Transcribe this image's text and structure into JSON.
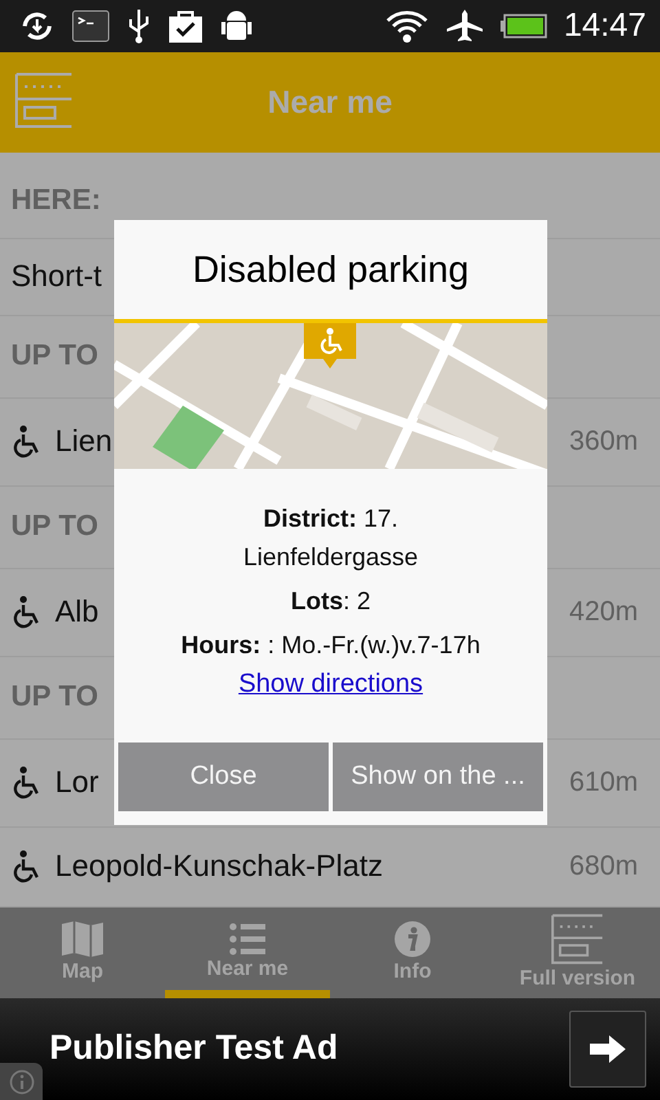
{
  "status_bar": {
    "time": "14:47"
  },
  "header": {
    "title": "Near me"
  },
  "list": [
    {
      "kind": "section",
      "label": "HERE:"
    },
    {
      "kind": "plain",
      "name": "Short-t"
    },
    {
      "kind": "section",
      "label": "UP TO"
    },
    {
      "kind": "place",
      "name": "Lien",
      "distance": "360m"
    },
    {
      "kind": "section",
      "label": "UP TO"
    },
    {
      "kind": "place",
      "name": "Alb",
      "distance": "420m"
    },
    {
      "kind": "section",
      "label": "UP TO"
    },
    {
      "kind": "place",
      "name": "Lor",
      "distance": "610m"
    },
    {
      "kind": "place",
      "name": "Leopold-Kunschak-Platz",
      "distance": "680m"
    }
  ],
  "dialog": {
    "title": "Disabled parking",
    "details": [
      "**District:** 17. Lienfeldergasse",
      "**Lots**: 2",
      "**Hours:** : Mo.-Fr.(w.)v.7-17h"
    ],
    "link": "Show directions",
    "buttons": [
      "Close",
      "Show on the ..."
    ]
  },
  "tabs": [
    {
      "label": "Map",
      "selected": false
    },
    {
      "label": "Near me",
      "selected": true
    },
    {
      "label": "Info",
      "selected": false
    },
    {
      "label": "Full version",
      "selected": false
    }
  ],
  "ad": {
    "text": "Publisher Test Ad"
  }
}
